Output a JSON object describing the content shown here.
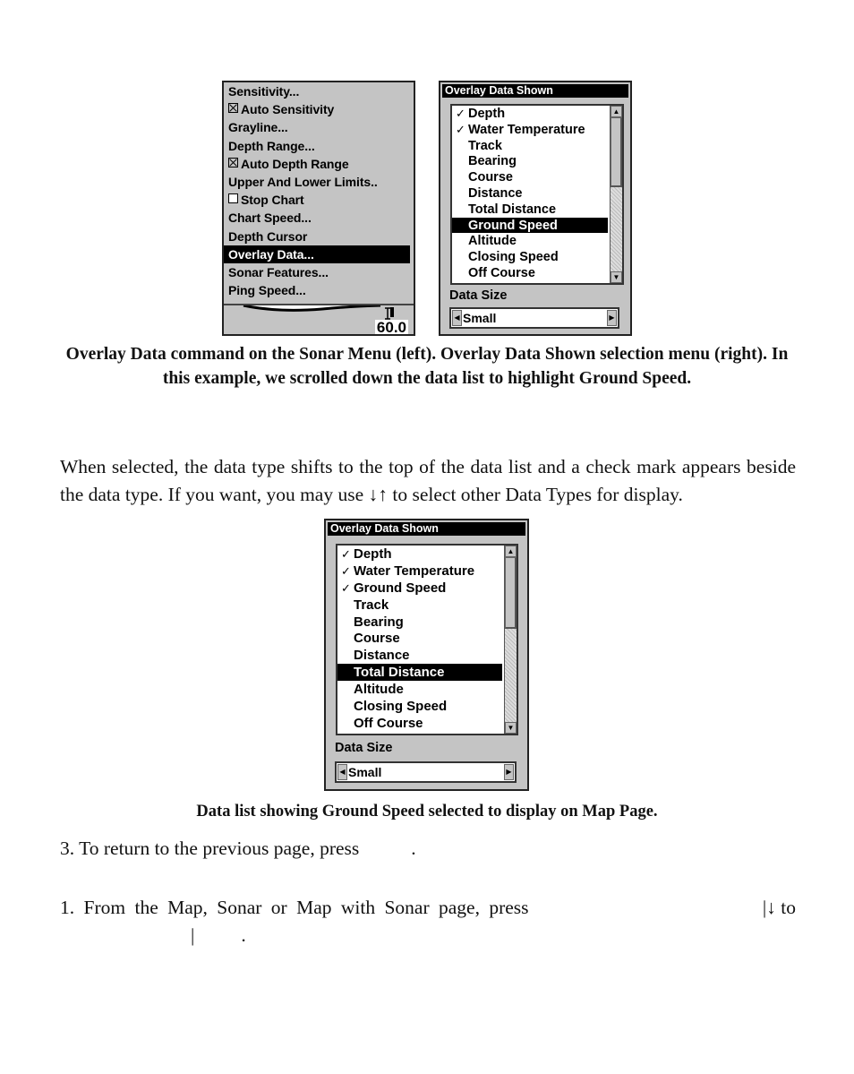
{
  "sonar_menu": {
    "items": [
      {
        "label": "Sensitivity...",
        "checkbox": null,
        "selected": false
      },
      {
        "label": "Auto Sensitivity",
        "checkbox": "checked",
        "selected": false
      },
      {
        "label": "Grayline...",
        "checkbox": null,
        "selected": false
      },
      {
        "label": "Depth Range...",
        "checkbox": null,
        "selected": false
      },
      {
        "label": "Auto Depth Range",
        "checkbox": "checked",
        "selected": false
      },
      {
        "label": "Upper And Lower Limits..",
        "checkbox": null,
        "selected": false
      },
      {
        "label": "Stop Chart",
        "checkbox": "unchecked",
        "selected": false
      },
      {
        "label": "Chart Speed...",
        "checkbox": null,
        "selected": false
      },
      {
        "label": "Depth Cursor",
        "checkbox": null,
        "selected": false
      },
      {
        "label": "Overlay Data...",
        "checkbox": null,
        "selected": true
      },
      {
        "label": "Sonar Features...",
        "checkbox": null,
        "selected": false
      },
      {
        "label": "Ping Speed...",
        "checkbox": null,
        "selected": false
      }
    ],
    "depth_readout": "60.0"
  },
  "overlay_dialog_1": {
    "title": "Overlay Data Shown",
    "items": [
      {
        "label": "Depth",
        "checked": true,
        "selected": false
      },
      {
        "label": "Water Temperature",
        "checked": true,
        "selected": false
      },
      {
        "label": "Track",
        "checked": false,
        "selected": false
      },
      {
        "label": "Bearing",
        "checked": false,
        "selected": false
      },
      {
        "label": "Course",
        "checked": false,
        "selected": false
      },
      {
        "label": "Distance",
        "checked": false,
        "selected": false
      },
      {
        "label": "Total Distance",
        "checked": false,
        "selected": false
      },
      {
        "label": "Ground Speed",
        "checked": false,
        "selected": true
      },
      {
        "label": "Altitude",
        "checked": false,
        "selected": false
      },
      {
        "label": "Closing Speed",
        "checked": false,
        "selected": false
      },
      {
        "label": "Off Course",
        "checked": false,
        "selected": false
      }
    ],
    "data_size_label": "Data Size",
    "data_size_value": "Small",
    "scroll_position": 0.0
  },
  "overlay_dialog_2": {
    "title": "Overlay Data Shown",
    "items": [
      {
        "label": "Depth",
        "checked": true,
        "selected": false
      },
      {
        "label": "Water Temperature",
        "checked": true,
        "selected": false
      },
      {
        "label": "Ground Speed",
        "checked": true,
        "selected": false
      },
      {
        "label": "Track",
        "checked": false,
        "selected": false
      },
      {
        "label": "Bearing",
        "checked": false,
        "selected": false
      },
      {
        "label": "Course",
        "checked": false,
        "selected": false
      },
      {
        "label": "Distance",
        "checked": false,
        "selected": false
      },
      {
        "label": "Total Distance",
        "checked": false,
        "selected": true
      },
      {
        "label": "Altitude",
        "checked": false,
        "selected": false
      },
      {
        "label": "Closing Speed",
        "checked": false,
        "selected": false
      },
      {
        "label": "Off Course",
        "checked": false,
        "selected": false
      }
    ],
    "data_size_label": "Data Size",
    "data_size_value": "Small",
    "scroll_position": 0.0
  },
  "icons": {
    "check": "✓",
    "scroll_up": "▲",
    "scroll_down": "▼",
    "arrow_left": "◀",
    "arrow_right": "▶"
  },
  "captions": {
    "figure_1": "Overlay Data command on the Sonar Menu (left). Overlay Data Shown selection menu (right). In this example, we scrolled down the data list to highlight Ground Speed.",
    "figure_2": "Data list showing Ground Speed selected to display on Map Page."
  },
  "paragraphs": {
    "p1": "When selected, the data type shifts to the top of the data list and a check mark appears beside the data type. If you want, you may use ↓↑ to select other Data Types for display.",
    "p2_before": "3. To return to the previous page, press",
    "p2_after": ".",
    "p3_line1_before": "1. From the Map, Sonar or Map with Sonar page, press",
    "p3_line1_after": "|↓ to",
    "p3_line2_sep": "|",
    "p3_line2_end": "."
  }
}
